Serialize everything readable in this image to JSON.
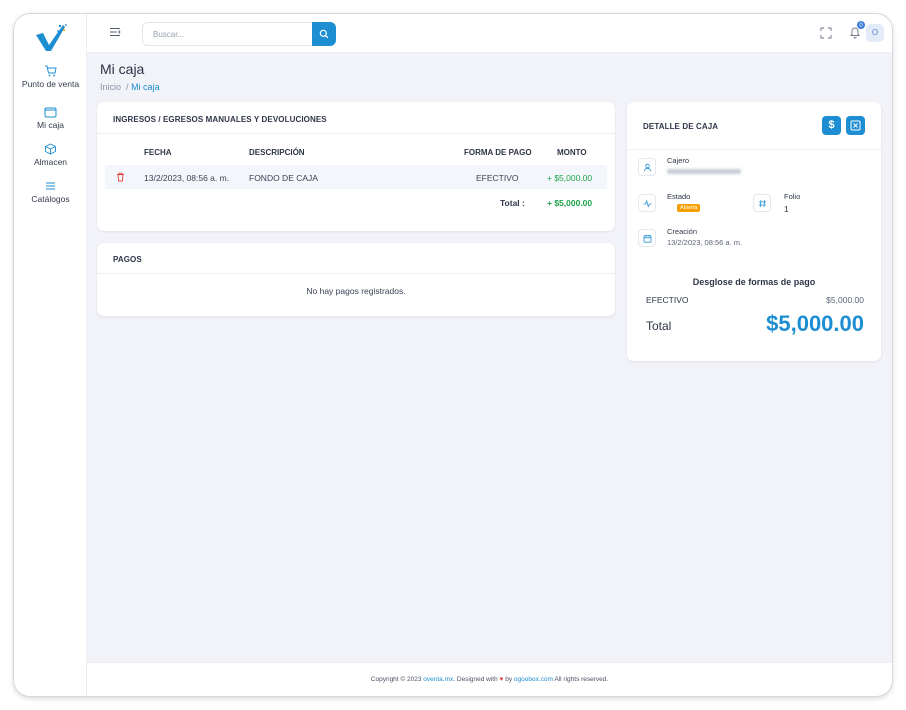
{
  "app": {
    "sidebar": {
      "items": [
        {
          "label": "Punto de venta",
          "icon": "cart-icon"
        },
        {
          "label": "Mi caja",
          "icon": "wallet-icon"
        },
        {
          "label": "Almacen",
          "icon": "cube-icon"
        },
        {
          "label": "Catálogos",
          "icon": "list-icon"
        }
      ]
    },
    "topbar": {
      "search_placeholder": "Buscar...",
      "notifications_count": "0",
      "avatar_initial": "O"
    }
  },
  "header": {
    "title": "Mi caja",
    "breadcrumb": {
      "home": "Inicio",
      "separator": "/",
      "current": "Mi caja"
    }
  },
  "movements": {
    "title": "INGRESOS / EGRESOS MANUALES Y DEVOLUCIONES",
    "columns": {
      "date": "FECHA",
      "description": "DESCRIPCIÓN",
      "payment": "FORMA DE PAGO",
      "amount": "MONTO"
    },
    "rows": [
      {
        "date": "13/2/2023, 08:56 a. m.",
        "description": "FONDO DE CAJA",
        "payment": "EFECTIVO",
        "amount": "+ $5,000.00"
      }
    ],
    "total_label": "Total :",
    "total_value": "+ $5,000.00"
  },
  "payments": {
    "title": "PAGOS",
    "empty_message": "No hay pagos registrados."
  },
  "detail": {
    "title": "DETALLE DE CAJA",
    "button_cash_symbol": "$",
    "cashier_label": "Cajero",
    "status_label": "Estado",
    "status_value": "Abierta",
    "folio_label": "Folio",
    "folio_value": "1",
    "created_label": "Creación",
    "created_value": "13/2/2023, 08:56 a. m.",
    "breakdown_title": "Desglose de formas de pago",
    "breakdown": [
      {
        "method": "EFECTIVO",
        "amount": "$5,000.00"
      }
    ],
    "total_label": "Total",
    "total_value": "$5,000.00"
  },
  "footer": {
    "prefix": "Copyright © 2023",
    "brand": "oventa.mx",
    "middle": ". Designed with",
    "by": "by",
    "company": "ogoobox.com",
    "suffix": "All rights reserved."
  },
  "colors": {
    "accent": "#1d8ed1",
    "success": "#1fa34a",
    "danger": "#e8413c",
    "warning": "#f59f00",
    "background": "#f2f3f8"
  }
}
